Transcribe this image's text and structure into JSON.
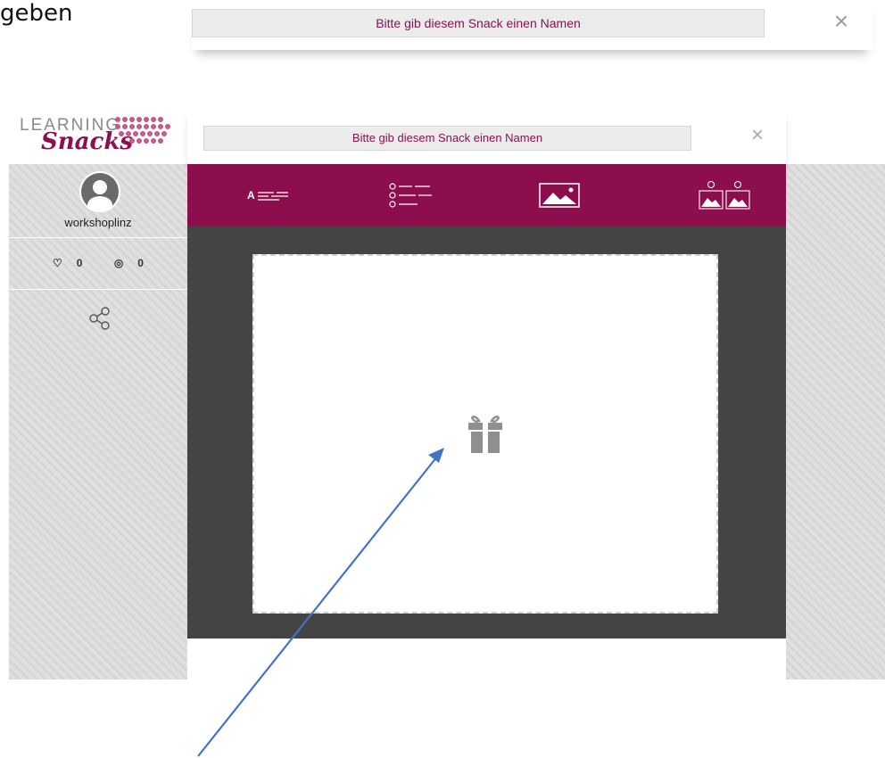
{
  "document": {
    "text_fragment": "geben"
  },
  "top_bar": {
    "title_placeholder": "Bitte gib diesem Snack einen Namen",
    "close_glyph": "×"
  },
  "logo": {
    "learning": "LEARNING",
    "snacks": "Snacks"
  },
  "profile": {
    "username": "workshoplinz",
    "likes": "0",
    "views": "0"
  },
  "header": {
    "title_placeholder": "Bitte gib diesem Snack einen Namen",
    "close_glyph": "×"
  },
  "toolbar": {
    "tools": [
      {
        "icon": "text-lines-icon",
        "letter": "A"
      },
      {
        "icon": "multiple-choice-icon"
      },
      {
        "icon": "single-image-icon"
      },
      {
        "icon": "image-choice-icon"
      }
    ]
  },
  "colors": {
    "brand": "#8c0e4d",
    "canvas_bg": "#444444",
    "arrow": "#4472c4"
  }
}
